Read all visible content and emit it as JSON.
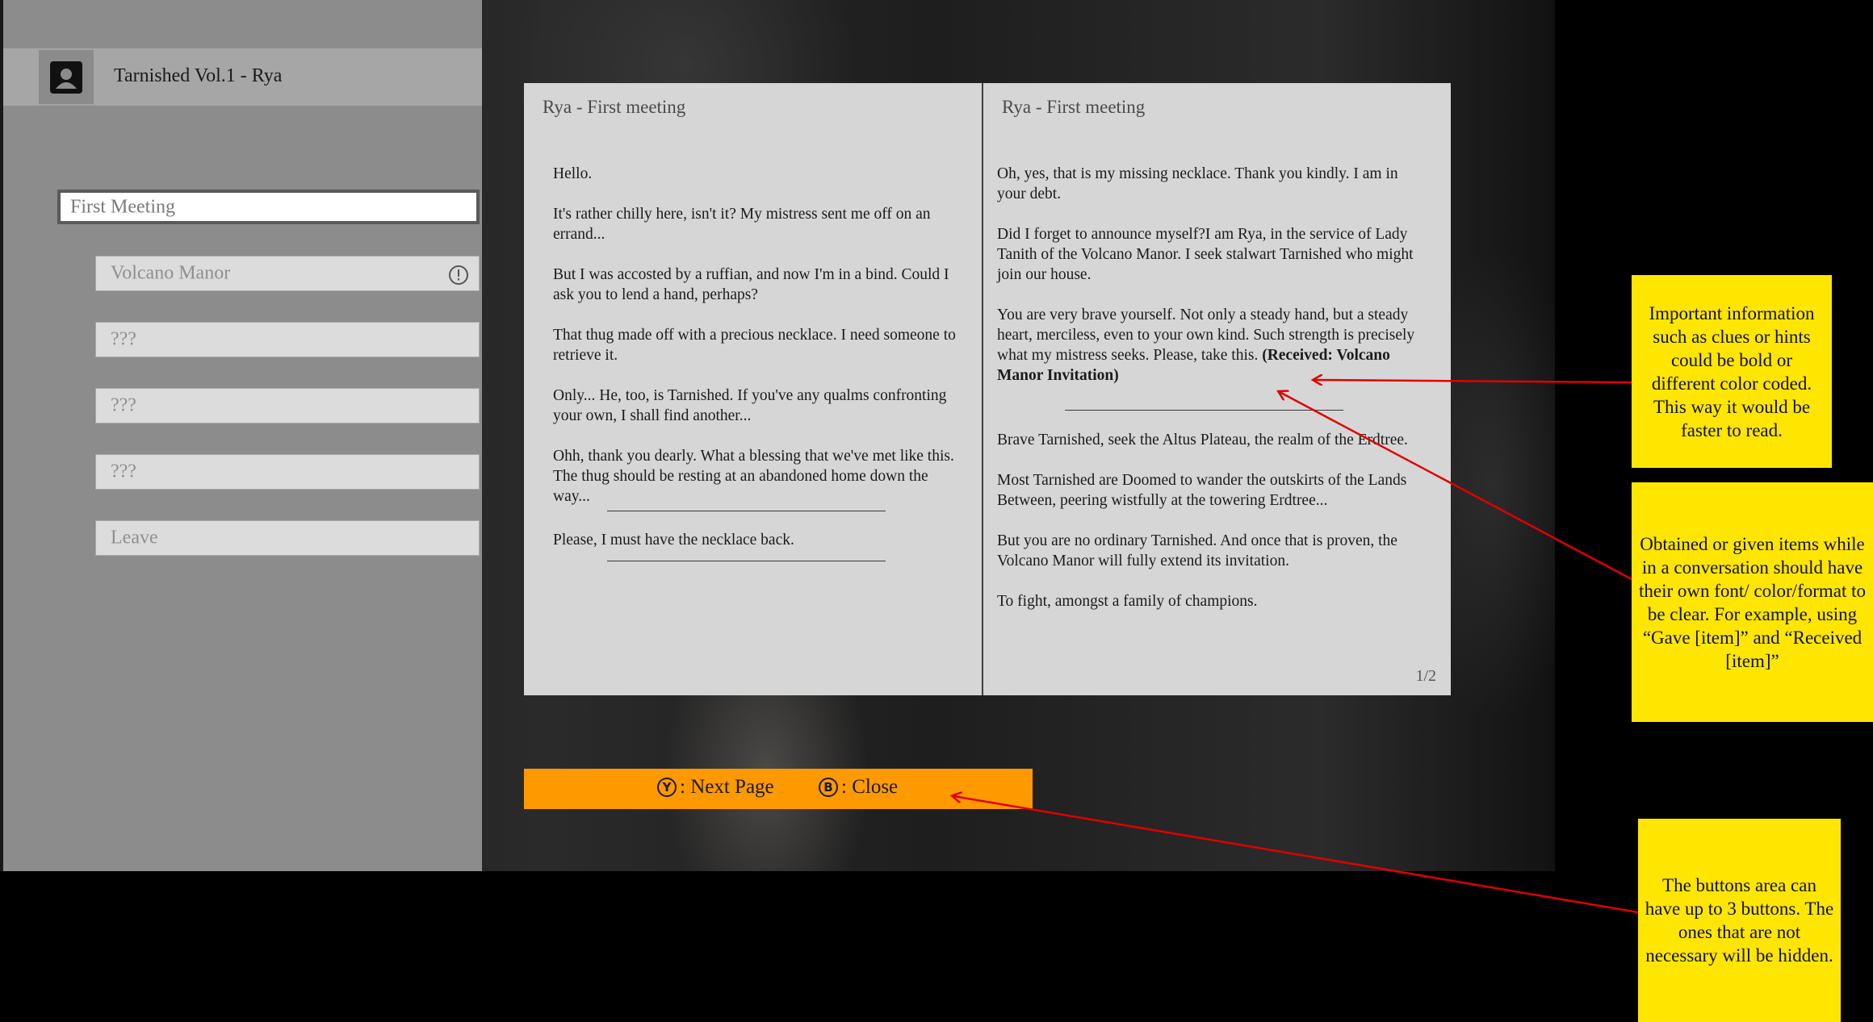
{
  "menu": {
    "title": "Tarnished Vol.1 - Rya",
    "options": [
      {
        "label": "First Meeting"
      },
      {
        "label": "Volcano Manor"
      },
      {
        "label": "???"
      },
      {
        "label": "???"
      },
      {
        "label": "???"
      },
      {
        "label": "Leave"
      }
    ]
  },
  "book": {
    "left": {
      "title": "Rya - First meeting",
      "paragraphs": [
        "Hello.",
        "It's rather chilly here, isn't it? My mistress sent me off on an errand...",
        "But I was accosted by a ruffian, and now I'm in a bind. Could I ask you to lend a hand, perhaps?",
        "That thug made off with a precious necklace. I need someone to retrieve it.",
        "Only... He, too, is Tarnished. If you've any qualms confronting your own, I shall find another...",
        "Ohh, thank you dearly. What a blessing that we've met like this. The thug should be resting at an abandoned home down the way...",
        "Please, I must have the necklace back."
      ]
    },
    "right": {
      "title": "Rya - First meeting",
      "paragraphs": [
        "Oh, yes, that is my missing necklace. Thank you kindly. I am in your debt.",
        "Did I forget to announce myself?I am Rya, in the service of Lady Tanith of the Volcano Manor. I seek stalwart Tarnished who might join our house.",
        "You are very brave yourself. Not only a steady hand, but a steady heart, merciless, even to your own kind. Such strength is precisely what my mistress seeks. Please, take this.",
        "Brave Tarnished, seek the Altus Plateau, the realm of the Erdtree.",
        "Most Tarnished are Doomed to wander the outskirts of the Lands Between, peering wistfully at the towering Erdtree...",
        "But you are no ordinary Tarnished. And once that is proven, the Volcano Manor will fully extend its invitation.",
        "To fight, amongst a family of champions."
      ],
      "received": "(Received: Volcano Manor Invitation)"
    },
    "page_indicator": "1/2"
  },
  "buttons": {
    "next": {
      "glyph": "Y",
      "label": ": Next Page"
    },
    "close": {
      "glyph": "B",
      "label": ": Close"
    }
  },
  "notes": [
    {
      "text": "Important information such as clues or hints could be bold or different color coded. This way it would be faster to read."
    },
    {
      "text": "Obtained or given items while in a conversation should have their own font/ color/format to be clear. For example, using “Gave [item]” and “Received [item]”"
    },
    {
      "text": "The buttons area can have up to 3 buttons. The ones that are not necessary will be hidden."
    }
  ],
  "colors": {
    "menu_bg": "#8c8c8c",
    "page_bg": "#d6d6d6",
    "button_bar": "#ff9900",
    "note_bg": "#ffe600",
    "arrow": "#e00000"
  },
  "icons": [
    "profile-icon",
    "alert-icon",
    "y-button-icon",
    "b-button-icon"
  ]
}
